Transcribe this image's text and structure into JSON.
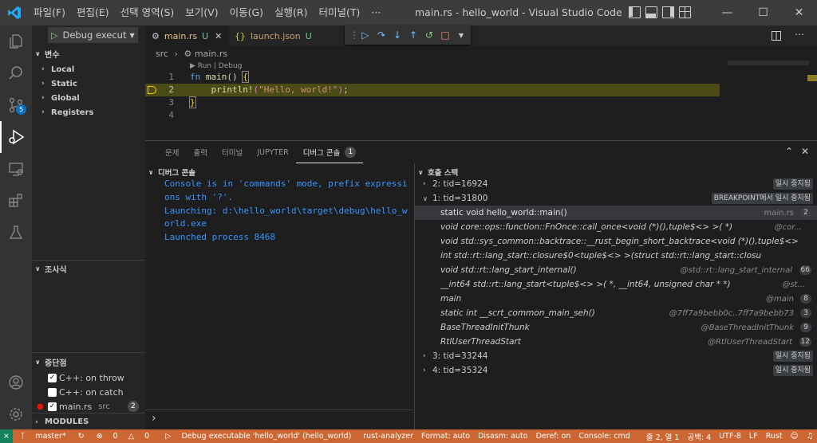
{
  "menu": [
    "파일(F)",
    "편집(E)",
    "선택 영역(S)",
    "보기(V)",
    "이동(G)",
    "실행(R)",
    "터미널(T)",
    "···"
  ],
  "window_title": "main.rs - hello_world - Visual Studio Code [...",
  "activity": {
    "scm_badge": "5"
  },
  "sidebar": {
    "debug_config": "Debug execut",
    "variables_header": "변수",
    "variables": [
      "Local",
      "Static",
      "Global",
      "Registers"
    ],
    "watch_header": "조사식",
    "breakpoints_header": "중단점",
    "breakpoints": [
      {
        "label": "C++: on throw",
        "checked": true
      },
      {
        "label": "C++: on catch",
        "checked": false
      },
      {
        "label": "main.rs",
        "dir": "src",
        "count": "2",
        "checked": true
      }
    ],
    "modules_header": "MODULES"
  },
  "tabs": [
    {
      "label": "main.rs",
      "status": "U"
    },
    {
      "label": "launch.json",
      "status": "U"
    }
  ],
  "breadcrumb": {
    "folder": "src",
    "file": "main.rs"
  },
  "codelens": "▶ Run | Debug",
  "code": [
    {
      "num": "1",
      "text": "fn main() {"
    },
    {
      "num": "2",
      "text": "    println!(\"Hello, world!\");"
    },
    {
      "num": "3",
      "text": "}"
    },
    {
      "num": "4",
      "text": ""
    }
  ],
  "panel": {
    "tabs": [
      "문제",
      "출력",
      "터미널",
      "JUPYTER",
      "디버그 콘솔"
    ],
    "active_count": "1",
    "console_title": "디버그 콘솔",
    "console_lines": [
      "Console is in 'commands' mode, prefix expressions with '?'.",
      "Launching: d:\\hello_world\\target\\debug\\hello_world.exe",
      "Launched process 8468"
    ],
    "callstack_title": "호출 스택",
    "threads": [
      {
        "label": "2: tid=16924",
        "state": "일시 중지됨",
        "expanded": false
      },
      {
        "label": "1: tid=31800",
        "state": "BREAKPOINT에서 일시 중지됨",
        "expanded": true
      }
    ],
    "frames": [
      {
        "fn": "static void hello_world::main()",
        "src": "main.rs",
        "line": "2",
        "italic": false
      },
      {
        "fn": "void core::ops::function::FnOnce::call_once<void (*)(),tuple$<> >( *)",
        "src": "@cor...",
        "line": "",
        "italic": true
      },
      {
        "fn": "void std::sys_common::backtrace::__rust_begin_short_backtrace<void (*)(),tuple$<>",
        "src": "",
        "line": "",
        "italic": true
      },
      {
        "fn": "int std::rt::lang_start::closure$0<tuple$<> >(struct std::rt::lang_start::closu",
        "src": "",
        "line": "",
        "italic": true
      },
      {
        "fn": "void std::rt::lang_start_internal()",
        "src": "@std::rt::lang_start_internal",
        "line": "66",
        "italic": true
      },
      {
        "fn": "__int64 std::rt::lang_start<tuple$<> >( *, __int64, unsigned char * *)",
        "src": "@st...",
        "line": "",
        "italic": true
      },
      {
        "fn": "main",
        "src": "@main",
        "line": "8",
        "italic": true
      },
      {
        "fn": "static int __scrt_common_main_seh()",
        "src": "@7ff7a9bebb0c..7ff7a9bebb73",
        "line": "3",
        "italic": true
      },
      {
        "fn": "BaseThreadInitThunk",
        "src": "@BaseThreadInitThunk",
        "line": "9",
        "italic": true
      },
      {
        "fn": "RtlUserThreadStart",
        "src": "@RtlUserThreadStart",
        "line": "12",
        "italic": true
      }
    ],
    "threads_after": [
      {
        "label": "3: tid=33244",
        "state": "일시 중지됨"
      },
      {
        "label": "4: tid=35324",
        "state": "일시 중지됨"
      }
    ]
  },
  "status": {
    "branch": "master*",
    "errors": "0",
    "warnings": "0",
    "debug": "Debug executable 'hello_world' (hello_world)",
    "items": [
      "rust-analyzer",
      "Format: auto",
      "Disasm: auto",
      "Deref: on",
      "Console: cmd"
    ],
    "position": "줄 2, 열 1",
    "spaces": "공백: 4",
    "encoding": "UTF-8",
    "eol": "LF",
    "lang": "Rust"
  }
}
